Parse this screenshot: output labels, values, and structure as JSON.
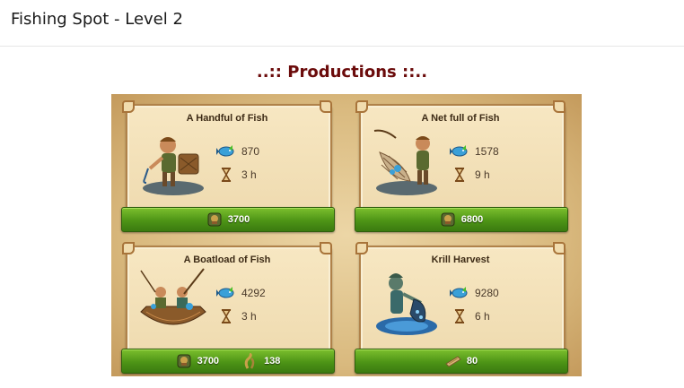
{
  "header": {
    "title": "Fishing Spot - Level 2"
  },
  "section": {
    "title": "..:: Productions ::.."
  },
  "productions": [
    {
      "title": "A Handful of Fish",
      "output": "870",
      "duration": "3 h",
      "costs": [
        {
          "icon": "supplies-icon",
          "value": "3700"
        }
      ]
    },
    {
      "title": "A Net full of Fish",
      "output": "1578",
      "duration": "9 h",
      "costs": [
        {
          "icon": "supplies-icon",
          "value": "6800"
        }
      ]
    },
    {
      "title": "A Boatload of Fish",
      "output": "4292",
      "duration": "3 h",
      "costs": [
        {
          "icon": "supplies-icon",
          "value": "3700"
        },
        {
          "icon": "seaweed-icon",
          "value": "138"
        }
      ]
    },
    {
      "title": "Krill Harvest",
      "output": "9280",
      "duration": "6 h",
      "costs": [
        {
          "icon": "plank-icon",
          "value": "80"
        }
      ]
    }
  ],
  "colors": {
    "title_red": "#6b0b0b",
    "bar_green": "#4d9416",
    "panel": "#f7e7c2"
  }
}
